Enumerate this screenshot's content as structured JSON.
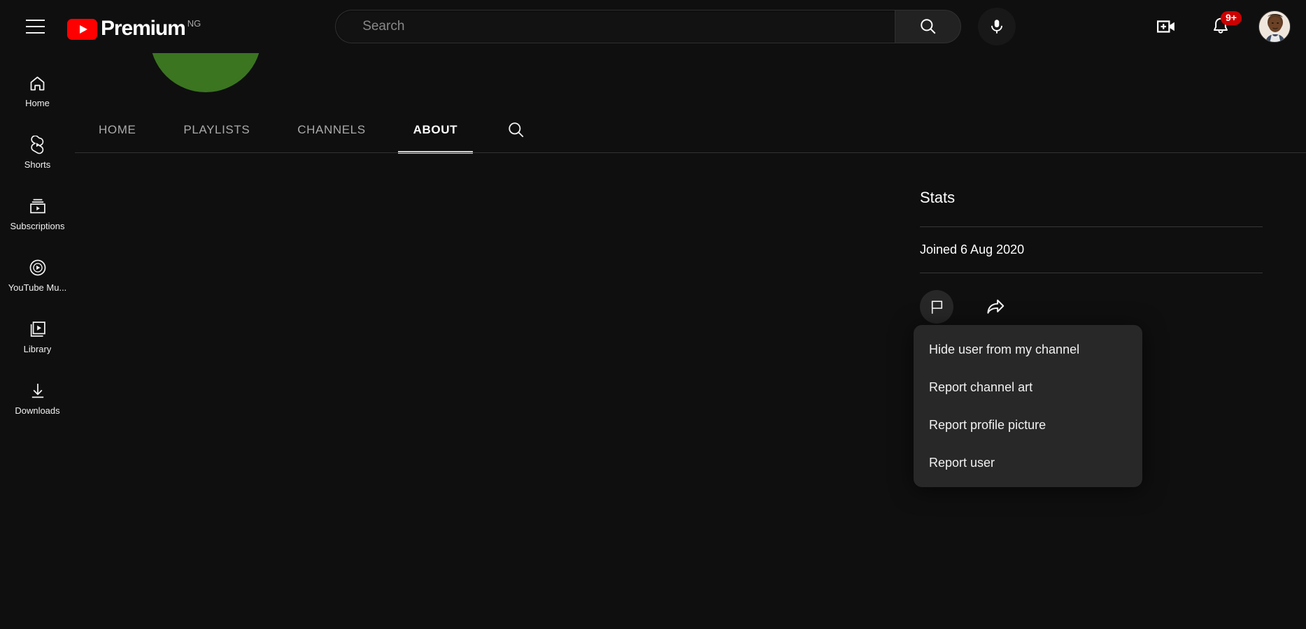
{
  "masthead": {
    "menu_icon": "hamburger-menu-icon",
    "logo_text": "Premium",
    "logo_country": "NG",
    "search": {
      "placeholder": "Search",
      "value": "",
      "search_icon": "search-icon",
      "voice_icon": "microphone-icon"
    },
    "create_icon": "create-video-icon",
    "notifications_icon": "notification-bell-icon",
    "notifications_badge": "9+",
    "avatar_icon": "account-avatar"
  },
  "guide": {
    "items": [
      {
        "label": "Home",
        "icon": "home-icon"
      },
      {
        "label": "Shorts",
        "icon": "shorts-icon"
      },
      {
        "label": "Subscriptions",
        "icon": "subscriptions-icon"
      },
      {
        "label": "YouTube Mu...",
        "icon": "youtube-music-icon"
      },
      {
        "label": "Library",
        "icon": "library-icon"
      },
      {
        "label": "Downloads",
        "icon": "downloads-icon"
      }
    ]
  },
  "channel": {
    "avatar_color": "#3b7520",
    "tabs": [
      {
        "label": "HOME",
        "active": false
      },
      {
        "label": "PLAYLISTS",
        "active": false
      },
      {
        "label": "CHANNELS",
        "active": false
      },
      {
        "label": "ABOUT",
        "active": true
      }
    ],
    "tab_search_icon": "search-icon"
  },
  "stats": {
    "title": "Stats",
    "joined": "Joined 6 Aug 2020",
    "report_icon": "flag-icon",
    "share_icon": "share-arrow-icon"
  },
  "dropdown": {
    "items": [
      {
        "label": "Hide user from my channel"
      },
      {
        "label": "Report channel art"
      },
      {
        "label": "Report profile picture"
      },
      {
        "label": "Report user"
      }
    ]
  },
  "colors": {
    "background": "#0f0f0f",
    "menu_background": "#282828",
    "brand_red": "#ff0000",
    "badge_red": "#cc0000",
    "text_primary": "#f1f1f1",
    "text_secondary": "#aaaaaa"
  }
}
